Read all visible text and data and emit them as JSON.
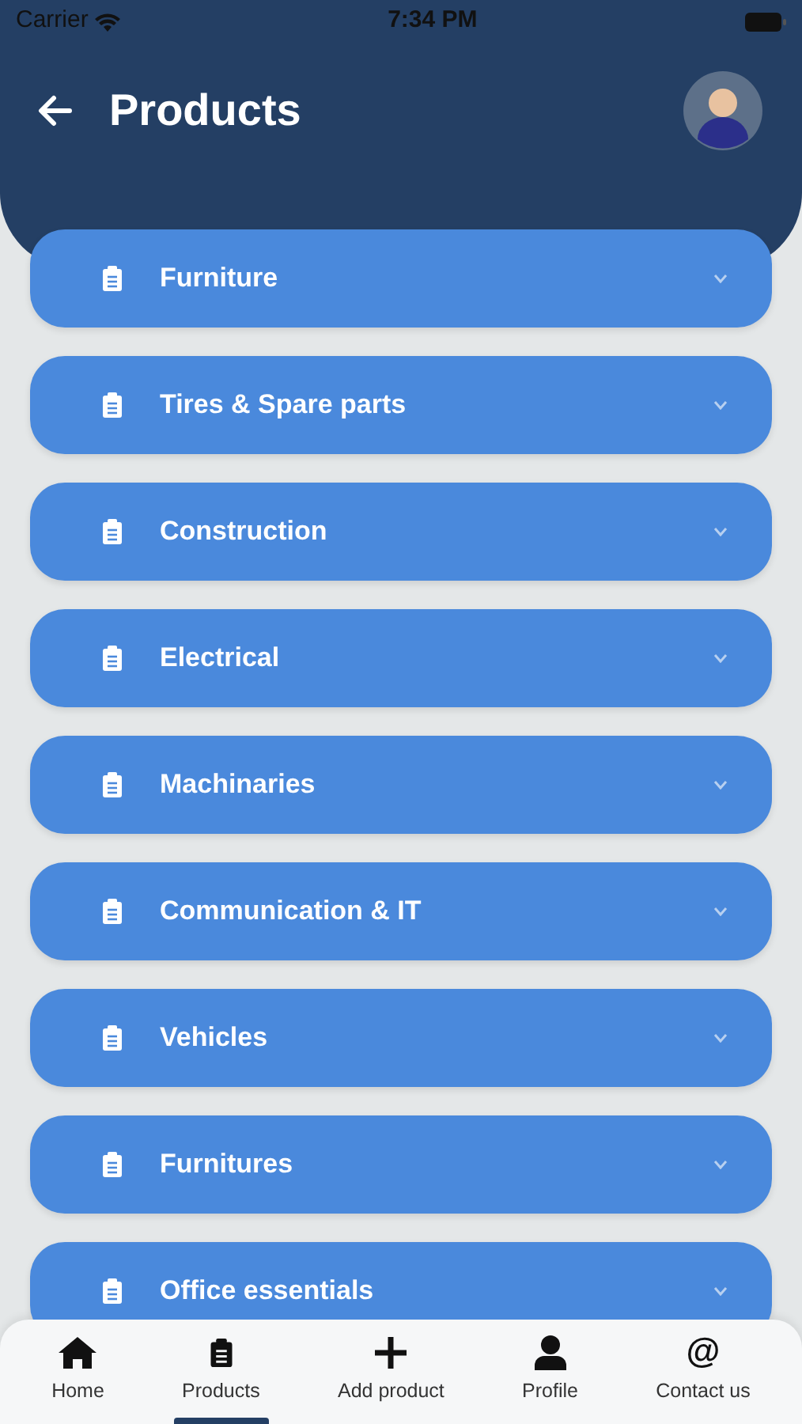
{
  "status_bar": {
    "carrier": "Carrier",
    "time": "7:34 PM"
  },
  "header": {
    "title": "Products"
  },
  "categories": [
    {
      "label": "Furniture",
      "expanded": false
    },
    {
      "label": "Tires & Spare parts",
      "expanded": false
    },
    {
      "label": "Construction",
      "expanded": false
    },
    {
      "label": "Electrical",
      "expanded": false
    },
    {
      "label": "Machinaries",
      "expanded": false
    },
    {
      "label": "Communication & IT",
      "expanded": false
    },
    {
      "label": "Vehicles",
      "expanded": false
    },
    {
      "label": "Furnitures",
      "expanded": false
    },
    {
      "label": "Office essentials",
      "expanded": false
    }
  ],
  "bottom_nav": [
    {
      "kind": "home",
      "label": "Home",
      "selected": false
    },
    {
      "kind": "clipboard",
      "label": "Products",
      "selected": true
    },
    {
      "kind": "plus",
      "label": "Add product",
      "selected": false
    },
    {
      "kind": "person",
      "label": "Profile",
      "selected": false
    },
    {
      "kind": "glyph",
      "icon": "@",
      "label": "Contact us",
      "selected": false
    }
  ]
}
